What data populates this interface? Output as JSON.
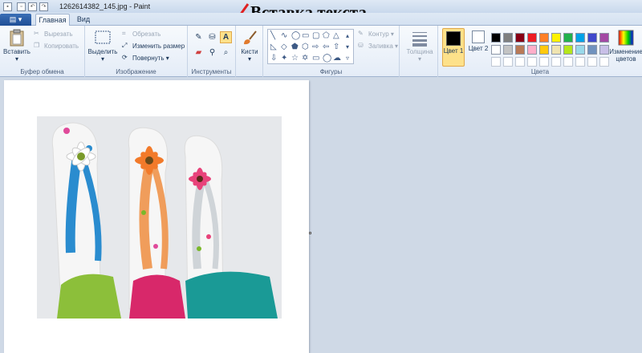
{
  "window": {
    "title": "1262614382_145.jpg - Paint"
  },
  "annotation": {
    "text": "Вставка текста"
  },
  "tabs": {
    "file": "",
    "home": "Главная",
    "view": "Вид"
  },
  "clipboard": {
    "paste": "Вставить",
    "cut": "Вырезать",
    "copy": "Копировать",
    "group": "Буфер обмена"
  },
  "image": {
    "select": "Выделить",
    "crop": "Обрезать",
    "resize": "Изменить размер",
    "rotate": "Повернуть",
    "group": "Изображение"
  },
  "tools": {
    "group": "Инструменты",
    "text_tool_glyph": "A"
  },
  "brushes": {
    "label": "Кисти"
  },
  "shapes": {
    "outline": "Контур",
    "fill": "Заливка",
    "group": "Фигуры"
  },
  "size": {
    "label": "Толщина"
  },
  "colors": {
    "color1": "Цвет 1",
    "color1_value": "#000000",
    "color2": "Цвет 2",
    "color2_value": "#ffffff",
    "edit": "Изменение цветов",
    "group": "Цвета",
    "palette_row1": [
      "#000000",
      "#7f7f7f",
      "#880015",
      "#ed1c24",
      "#ff7f27",
      "#fff200",
      "#22b14c",
      "#00a2e8",
      "#3f48cc",
      "#a349a4"
    ],
    "palette_row2": [
      "#ffffff",
      "#c3c3c3",
      "#b97a57",
      "#ffaec9",
      "#ffc90e",
      "#efe4b0",
      "#b5e61d",
      "#99d9ea",
      "#7092be",
      "#c8bfe7"
    ],
    "palette_row3": [
      "#ffffff",
      "#ffffff",
      "#ffffff",
      "#ffffff",
      "#ffffff",
      "#ffffff",
      "#ffffff",
      "#ffffff",
      "#ffffff",
      "#ffffff"
    ]
  }
}
